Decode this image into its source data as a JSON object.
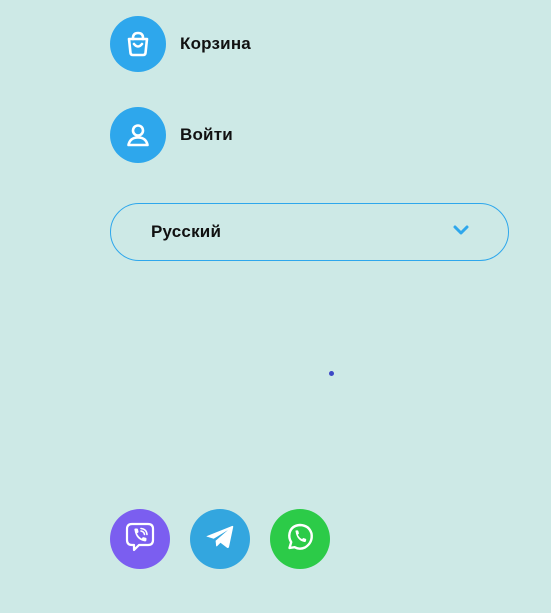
{
  "menu": {
    "cart_label": "Корзина",
    "login_label": "Войти"
  },
  "language_select": {
    "selected": "Русский"
  },
  "socials": [
    {
      "name": "viber",
      "icon": "viber-icon",
      "color": "#7b5ef0"
    },
    {
      "name": "telegram",
      "icon": "telegram-icon",
      "color": "#33a6df"
    },
    {
      "name": "whatsapp",
      "icon": "whatsapp-icon",
      "color": "#2ccb48"
    }
  ],
  "colors": {
    "background": "#cde9e6",
    "accent": "#2ea7ec",
    "text": "#111111"
  }
}
